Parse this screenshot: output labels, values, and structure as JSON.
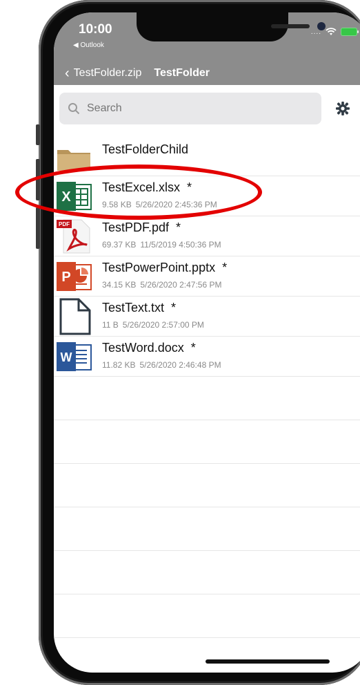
{
  "status_bar": {
    "time": "10:00",
    "back_app": "◀ Outlook",
    "signal": "....",
    "wifi_icon": "wifi-icon",
    "battery_icon": "battery-icon"
  },
  "nav": {
    "back_label": "TestFolder.zip",
    "title": "TestFolder"
  },
  "search": {
    "placeholder": "Search",
    "settings_icon": "gear-icon"
  },
  "files": [
    {
      "name": "TestFolderChild",
      "type": "folder",
      "star": "",
      "size": "",
      "date": ""
    },
    {
      "name": "TestExcel.xlsx",
      "type": "excel",
      "star": "*",
      "size": "9.58 KB",
      "date": "5/26/2020 2:45:36 PM"
    },
    {
      "name": "TestPDF.pdf",
      "type": "pdf",
      "star": "*",
      "size": "69.37 KB",
      "date": "11/5/2019 4:50:36 PM"
    },
    {
      "name": "TestPowerPoint.pptx",
      "type": "powerpoint",
      "star": "*",
      "size": "34.15 KB",
      "date": "5/26/2020 2:47:56 PM"
    },
    {
      "name": "TestText.txt",
      "type": "text",
      "star": "*",
      "size": "11 B",
      "date": "5/26/2020 2:57:00 PM"
    },
    {
      "name": "TestWord.docx",
      "type": "word",
      "star": "*",
      "size": "11.82 KB",
      "date": "5/26/2020 2:46:48 PM"
    }
  ],
  "colors": {
    "nav_bg": "#8c8c8c",
    "annotation": "#e30000",
    "excel": "#1e7145",
    "pdf": "#c4161c",
    "powerpoint": "#d24726",
    "word": "#2b579a",
    "folder": "#c7a86b"
  }
}
